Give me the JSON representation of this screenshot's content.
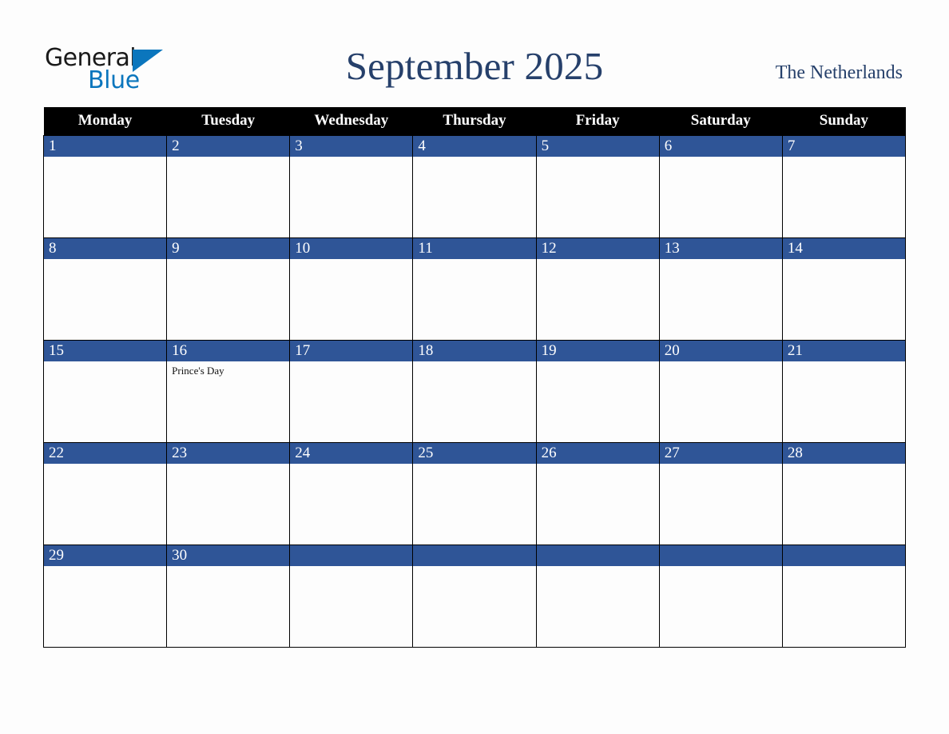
{
  "brand": {
    "name_part1": "General",
    "name_part2": "Blue",
    "triangle_color": "#0b76bd",
    "text_color": "#1a1a1a"
  },
  "header": {
    "title": "September 2025",
    "country": "The Netherlands",
    "title_color": "#26406b"
  },
  "calendar": {
    "weekdays": [
      "Monday",
      "Tuesday",
      "Wednesday",
      "Thursday",
      "Friday",
      "Saturday",
      "Sunday"
    ],
    "header_bg": "#000000",
    "header_fg": "#ffffff",
    "day_band_bg": "#2f5597",
    "day_band_fg": "#ffffff",
    "cell_bg": "#fdfdfd",
    "border_color": "#000000",
    "weeks": [
      [
        {
          "date": "1",
          "events": []
        },
        {
          "date": "2",
          "events": []
        },
        {
          "date": "3",
          "events": []
        },
        {
          "date": "4",
          "events": []
        },
        {
          "date": "5",
          "events": []
        },
        {
          "date": "6",
          "events": []
        },
        {
          "date": "7",
          "events": []
        }
      ],
      [
        {
          "date": "8",
          "events": []
        },
        {
          "date": "9",
          "events": []
        },
        {
          "date": "10",
          "events": []
        },
        {
          "date": "11",
          "events": []
        },
        {
          "date": "12",
          "events": []
        },
        {
          "date": "13",
          "events": []
        },
        {
          "date": "14",
          "events": []
        }
      ],
      [
        {
          "date": "15",
          "events": []
        },
        {
          "date": "16",
          "events": [
            "Prince's Day"
          ]
        },
        {
          "date": "17",
          "events": []
        },
        {
          "date": "18",
          "events": []
        },
        {
          "date": "19",
          "events": []
        },
        {
          "date": "20",
          "events": []
        },
        {
          "date": "21",
          "events": []
        }
      ],
      [
        {
          "date": "22",
          "events": []
        },
        {
          "date": "23",
          "events": []
        },
        {
          "date": "24",
          "events": []
        },
        {
          "date": "25",
          "events": []
        },
        {
          "date": "26",
          "events": []
        },
        {
          "date": "27",
          "events": []
        },
        {
          "date": "28",
          "events": []
        }
      ],
      [
        {
          "date": "29",
          "events": []
        },
        {
          "date": "30",
          "events": []
        },
        {
          "date": "",
          "events": []
        },
        {
          "date": "",
          "events": []
        },
        {
          "date": "",
          "events": []
        },
        {
          "date": "",
          "events": []
        },
        {
          "date": "",
          "events": []
        }
      ]
    ]
  }
}
